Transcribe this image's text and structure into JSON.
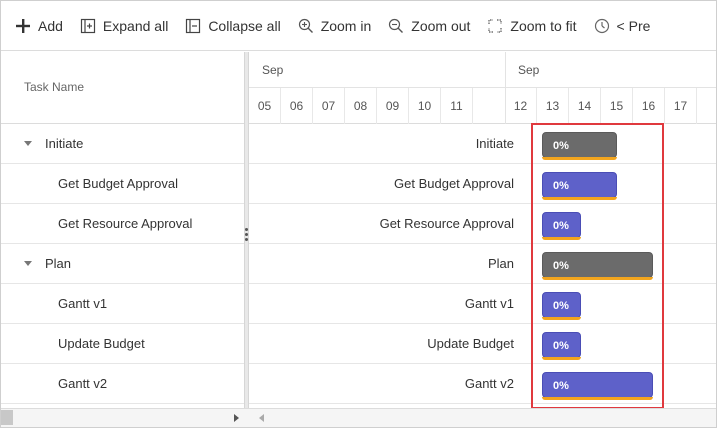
{
  "toolbar": {
    "items": [
      {
        "label": "Add",
        "icon": "plus-icon"
      },
      {
        "label": "Expand all",
        "icon": "expand-all-icon"
      },
      {
        "label": "Collapse all",
        "icon": "collapse-all-icon"
      },
      {
        "label": "Zoom in",
        "icon": "zoom-in-icon"
      },
      {
        "label": "Zoom out",
        "icon": "zoom-out-icon"
      },
      {
        "label": "Zoom to fit",
        "icon": "zoom-to-fit-icon"
      },
      {
        "label": "< Pre",
        "icon": "clock-icon"
      }
    ]
  },
  "grid": {
    "header": "Task Name",
    "rows": [
      {
        "label": "Initiate",
        "expandable": true
      },
      {
        "label": "Get Budget Approval",
        "expandable": false
      },
      {
        "label": "Get Resource Approval",
        "expandable": false
      },
      {
        "label": "Plan",
        "expandable": true
      },
      {
        "label": "Gantt v1",
        "expandable": false
      },
      {
        "label": "Update Budget",
        "expandable": false
      },
      {
        "label": "Gantt v2",
        "expandable": false
      }
    ]
  },
  "timeline": {
    "months": [
      "Sep",
      "Sep"
    ],
    "days": [
      "05",
      "06",
      "07",
      "08",
      "09",
      "10",
      "11",
      "12",
      "13",
      "14",
      "15",
      "16",
      "17"
    ]
  },
  "bars": [
    {
      "label": "Initiate",
      "progress_text": "0%",
      "progress": 0,
      "type": "parent"
    },
    {
      "label": "Get Budget Approval",
      "progress_text": "0%",
      "progress": 0,
      "type": "child"
    },
    {
      "label": "Get Resource Approval",
      "progress_text": "0%",
      "progress": 0,
      "type": "child"
    },
    {
      "label": "Plan",
      "progress_text": "0%",
      "progress": 0,
      "type": "parent"
    },
    {
      "label": "Gantt v1",
      "progress_text": "0%",
      "progress": 0,
      "type": "child"
    },
    {
      "label": "Update Budget",
      "progress_text": "0%",
      "progress": 0,
      "type": "child"
    },
    {
      "label": "Gantt v2",
      "progress_text": "0%",
      "progress": 0,
      "type": "child"
    }
  ],
  "colors": {
    "parent_bar": "#6b6b6b",
    "child_bar": "#5e61c9",
    "progress_line": "#f2a51e",
    "highlight_box": "#e0393e"
  }
}
